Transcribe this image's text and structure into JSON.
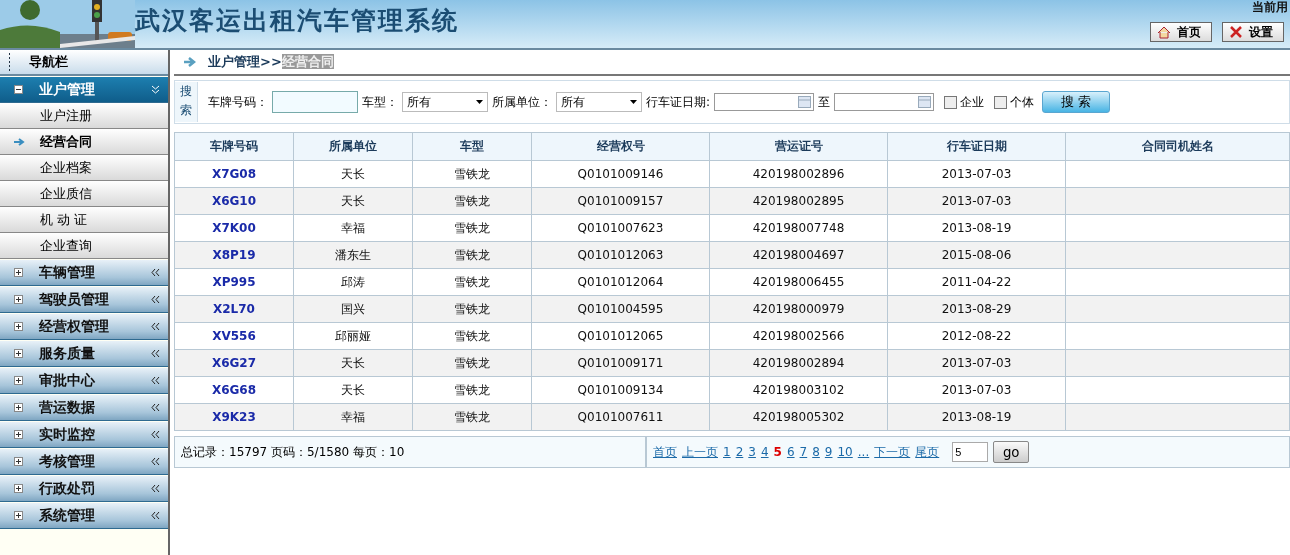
{
  "header": {
    "title": "武汉客运出租汽车管理系统",
    "user_label": "当前用",
    "buttons": [
      {
        "kind": "home",
        "label": "首页"
      },
      {
        "kind": "settings",
        "label": "设置"
      }
    ]
  },
  "sidebar": {
    "title": "导航栏",
    "groups": [
      {
        "label": "业户管理",
        "expanded": true,
        "children": [
          {
            "label": "业户注册",
            "selected": false
          },
          {
            "label": "经营合同",
            "selected": true
          },
          {
            "label": "企业档案",
            "selected": false
          },
          {
            "label": "企业质信",
            "selected": false
          },
          {
            "label": "机 动 证",
            "selected": false
          },
          {
            "label": "企业查询",
            "selected": false
          }
        ]
      },
      {
        "label": "车辆管理",
        "expanded": false
      },
      {
        "label": "驾驶员管理",
        "expanded": false
      },
      {
        "label": "经营权管理",
        "expanded": false
      },
      {
        "label": "服务质量",
        "expanded": false
      },
      {
        "label": "审批中心",
        "expanded": false
      },
      {
        "label": "营运数据",
        "expanded": false
      },
      {
        "label": "实时监控",
        "expanded": false
      },
      {
        "label": "考核管理",
        "expanded": false
      },
      {
        "label": "行政处罚",
        "expanded": false
      },
      {
        "label": "系统管理",
        "expanded": false
      }
    ]
  },
  "breadcrumb": {
    "parent": "业户管理>>",
    "current": "经营合同"
  },
  "search": {
    "tab": "搜索",
    "plate_label": "车牌号码：",
    "type_label": "车型：",
    "type_value": "所有",
    "unit_label": "所属单位：",
    "unit_value": "所有",
    "date_label": "行车证日期:",
    "to_label": "至",
    "checkboxes": [
      {
        "label": "企业",
        "checked": false
      },
      {
        "label": "个体",
        "checked": false
      }
    ],
    "button": "搜 索"
  },
  "table": {
    "columns": [
      "车牌号码",
      "所属单位",
      "车型",
      "经营权号",
      "营运证号",
      "行车证日期",
      "合同司机姓名"
    ],
    "rows": [
      [
        "X7G08",
        "天长",
        "雪铁龙",
        "Q0101009146",
        "420198002896",
        "2013-07-03",
        ""
      ],
      [
        "X6G10",
        "天长",
        "雪铁龙",
        "Q0101009157",
        "420198002895",
        "2013-07-03",
        ""
      ],
      [
        "X7K00",
        "幸福",
        "雪铁龙",
        "Q0101007623",
        "420198007748",
        "2013-08-19",
        ""
      ],
      [
        "X8P19",
        "潘东生",
        "雪铁龙",
        "Q0101012063",
        "420198004697",
        "2015-08-06",
        ""
      ],
      [
        "XP995",
        "邱涛",
        "雪铁龙",
        "Q0101012064",
        "420198006455",
        "2011-04-22",
        ""
      ],
      [
        "X2L70",
        "国兴",
        "雪铁龙",
        "Q0101004595",
        "420198000979",
        "2013-08-29",
        ""
      ],
      [
        "XV556",
        "邱丽娅",
        "雪铁龙",
        "Q0101012065",
        "420198002566",
        "2012-08-22",
        ""
      ],
      [
        "X6G27",
        "天长",
        "雪铁龙",
        "Q0101009171",
        "420198002894",
        "2013-07-03",
        ""
      ],
      [
        "X6G68",
        "天长",
        "雪铁龙",
        "Q0101009134",
        "420198003102",
        "2013-07-03",
        ""
      ],
      [
        "X9K23",
        "幸福",
        "雪铁龙",
        "Q0101007611",
        "420198005302",
        "2013-08-19",
        ""
      ]
    ]
  },
  "pager": {
    "summary": "总记录：15797 页码：5/1580 每页：10",
    "links": [
      {
        "label": "首页",
        "selected": false
      },
      {
        "label": "上一页",
        "selected": false
      },
      {
        "label": "1",
        "selected": false
      },
      {
        "label": "2",
        "selected": false
      },
      {
        "label": "3",
        "selected": false
      },
      {
        "label": "4",
        "selected": false
      },
      {
        "label": "5",
        "selected": true
      },
      {
        "label": "6",
        "selected": false
      },
      {
        "label": "7",
        "selected": false
      },
      {
        "label": "8",
        "selected": false
      },
      {
        "label": "9",
        "selected": false
      },
      {
        "label": "10",
        "selected": false
      },
      {
        "label": "...",
        "selected": false
      },
      {
        "label": "下一页",
        "selected": false
      },
      {
        "label": "尾页",
        "selected": false
      }
    ],
    "page_value": "5",
    "go": "go"
  }
}
